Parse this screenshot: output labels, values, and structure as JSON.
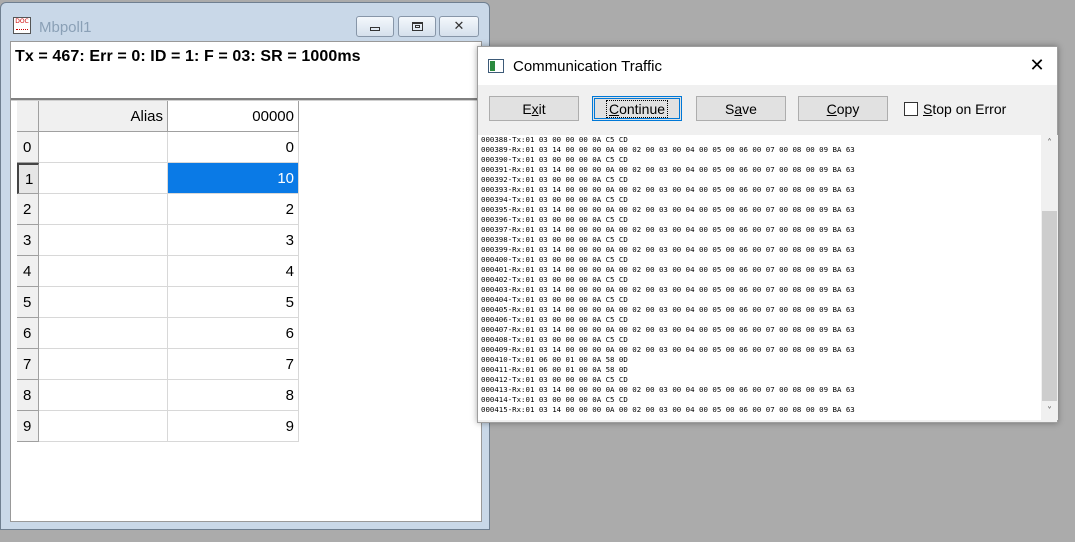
{
  "mbpoll": {
    "title": "Mbpoll1",
    "app_icon_text": "DOC",
    "status": "Tx = 467: Err = 0: ID = 1: F = 03: SR = 1000ms",
    "columns": [
      "Alias",
      "00000"
    ],
    "rows": [
      {
        "index": "0",
        "alias": "",
        "value": "0"
      },
      {
        "index": "1",
        "alias": "",
        "value": "10"
      },
      {
        "index": "2",
        "alias": "",
        "value": "2"
      },
      {
        "index": "3",
        "alias": "",
        "value": "3"
      },
      {
        "index": "4",
        "alias": "",
        "value": "4"
      },
      {
        "index": "5",
        "alias": "",
        "value": "5"
      },
      {
        "index": "6",
        "alias": "",
        "value": "6"
      },
      {
        "index": "7",
        "alias": "",
        "value": "7"
      },
      {
        "index": "8",
        "alias": "",
        "value": "8"
      },
      {
        "index": "9",
        "alias": "",
        "value": "9"
      }
    ],
    "selected_row": "1"
  },
  "comm": {
    "title": "Communication Traffic",
    "buttons": {
      "exit": {
        "pre": "E",
        "key": "x",
        "post": "it"
      },
      "continue": {
        "pre": "",
        "key": "C",
        "post": "ontinue"
      },
      "save": {
        "pre": "S",
        "key": "a",
        "post": "ve"
      },
      "copy": {
        "pre": "",
        "key": "C",
        "post": "opy"
      }
    },
    "stop_on_error": {
      "pre": "",
      "key": "S",
      "post": "top on Error",
      "checked": false
    },
    "log": [
      "000388-Tx:01 03 00 00 00 0A C5 CD",
      "000389-Rx:01 03 14 00 00 00 0A 00 02 00 03 00 04 00 05 00 06 00 07 00 08 00 09 BA 63",
      "000390-Tx:01 03 00 00 00 0A C5 CD",
      "000391-Rx:01 03 14 00 00 00 0A 00 02 00 03 00 04 00 05 00 06 00 07 00 08 00 09 BA 63",
      "000392-Tx:01 03 00 00 00 0A C5 CD",
      "000393-Rx:01 03 14 00 00 00 0A 00 02 00 03 00 04 00 05 00 06 00 07 00 08 00 09 BA 63",
      "000394-Tx:01 03 00 00 00 0A C5 CD",
      "000395-Rx:01 03 14 00 00 00 0A 00 02 00 03 00 04 00 05 00 06 00 07 00 08 00 09 BA 63",
      "000396-Tx:01 03 00 00 00 0A C5 CD",
      "000397-Rx:01 03 14 00 00 00 0A 00 02 00 03 00 04 00 05 00 06 00 07 00 08 00 09 BA 63",
      "000398-Tx:01 03 00 00 00 0A C5 CD",
      "000399-Rx:01 03 14 00 00 00 0A 00 02 00 03 00 04 00 05 00 06 00 07 00 08 00 09 BA 63",
      "000400-Tx:01 03 00 00 00 0A C5 CD",
      "000401-Rx:01 03 14 00 00 00 0A 00 02 00 03 00 04 00 05 00 06 00 07 00 08 00 09 BA 63",
      "000402-Tx:01 03 00 00 00 0A C5 CD",
      "000403-Rx:01 03 14 00 00 00 0A 00 02 00 03 00 04 00 05 00 06 00 07 00 08 00 09 BA 63",
      "000404-Tx:01 03 00 00 00 0A C5 CD",
      "000405-Rx:01 03 14 00 00 00 0A 00 02 00 03 00 04 00 05 00 06 00 07 00 08 00 09 BA 63",
      "000406-Tx:01 03 00 00 00 0A C5 CD",
      "000407-Rx:01 03 14 00 00 00 0A 00 02 00 03 00 04 00 05 00 06 00 07 00 08 00 09 BA 63",
      "000408-Tx:01 03 00 00 00 0A C5 CD",
      "000409-Rx:01 03 14 00 00 00 0A 00 02 00 03 00 04 00 05 00 06 00 07 00 08 00 09 BA 63",
      "000410-Tx:01 06 00 01 00 0A 58 0D",
      "000411-Rx:01 06 00 01 00 0A 58 0D",
      "000412-Tx:01 03 00 00 00 0A C5 CD",
      "000413-Rx:01 03 14 00 00 00 0A 00 02 00 03 00 04 00 05 00 06 00 07 00 08 00 09 BA 63",
      "000414-Tx:01 03 00 00 00 0A C5 CD",
      "000415-Rx:01 03 14 00 00 00 0A 00 02 00 03 00 04 00 05 00 06 00 07 00 08 00 09 BA 63"
    ],
    "scrollbar": {
      "up_icon": "chevron-up-icon",
      "down_icon": "chevron-down-icon"
    }
  }
}
